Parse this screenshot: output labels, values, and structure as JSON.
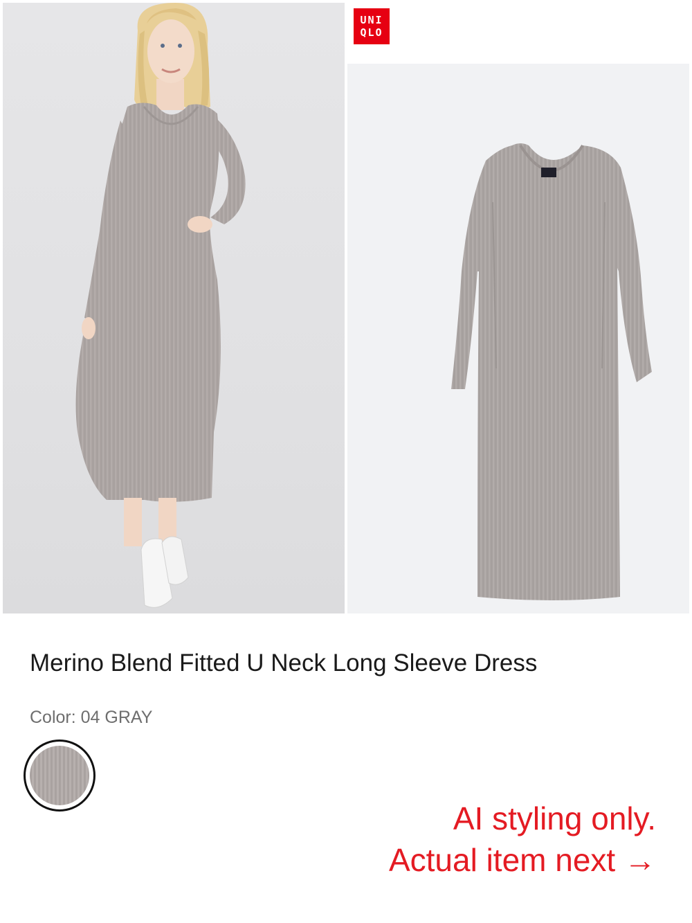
{
  "brand": {
    "logo_line1": "UNI",
    "logo_line2": "QLO"
  },
  "product": {
    "title": "Merino Blend Fitted U Neck Long Sleeve Dress",
    "color_label": "Color: 04 GRAY"
  },
  "caption": {
    "line1": "AI styling only.",
    "line2": "Actual item next →"
  },
  "colors": {
    "brand_red": "#e60012",
    "caption_red": "#e41b23",
    "dress_gray": "#a9a2a0"
  }
}
